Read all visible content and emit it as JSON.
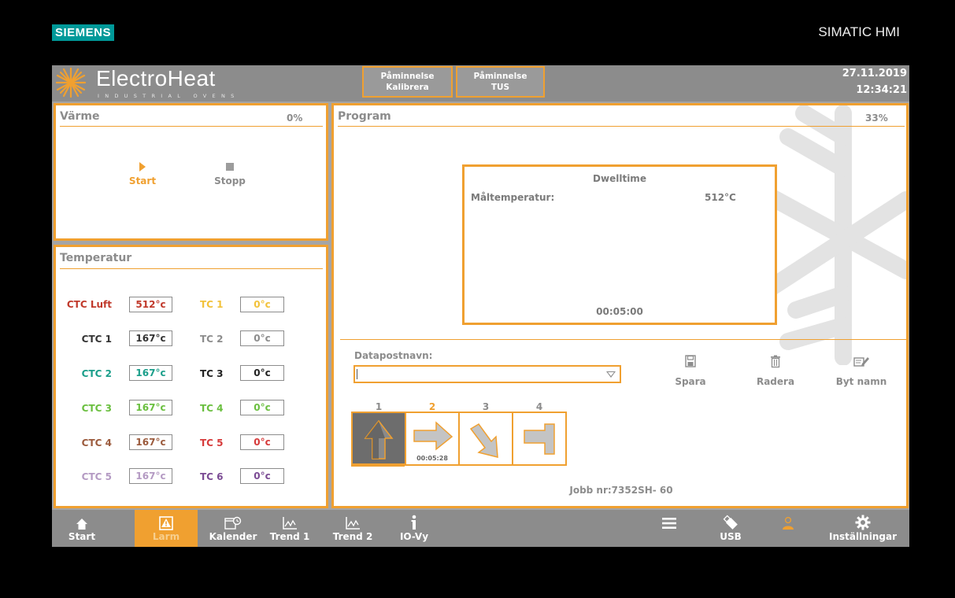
{
  "bezel": {
    "brand": "SIEMENS",
    "model": "SIMATIC HMI"
  },
  "header": {
    "logo_title": "ElectroHeat",
    "logo_subtitle": "INDUSTRIAL OVENS",
    "reminders": [
      {
        "line1": "Påminnelse",
        "line2": "Kalibrera"
      },
      {
        "line1": "Påminnelse",
        "line2": "TUS"
      }
    ],
    "date": "27.11.2019",
    "time": "12:34:21"
  },
  "varme": {
    "title": "Värme",
    "percent": "0%",
    "start_label": "Start",
    "stop_label": "Stopp"
  },
  "temperatur": {
    "title": "Temperatur",
    "left": [
      {
        "label": "CTC Luft",
        "value": "512°c",
        "color": "#c0392b"
      },
      {
        "label": "CTC 1",
        "value": "167°c",
        "color": "#333333"
      },
      {
        "label": "CTC 2",
        "value": "167°c",
        "color": "#1a9e8a"
      },
      {
        "label": "CTC 3",
        "value": "167°c",
        "color": "#6abf3f"
      },
      {
        "label": "CTC 4",
        "value": "167°c",
        "color": "#9b5a3c"
      },
      {
        "label": "CTC 5",
        "value": "167°c",
        "color": "#b49ac3"
      }
    ],
    "right": [
      {
        "label": "TC 1",
        "value": "0°c",
        "color": "#f2c23a"
      },
      {
        "label": "TC 2",
        "value": "0°c",
        "color": "#8c8c8c"
      },
      {
        "label": "TC 3",
        "value": "0°c",
        "color": "#222222"
      },
      {
        "label": "TC 4",
        "value": "0°c",
        "color": "#6abf3f"
      },
      {
        "label": "TC 5",
        "value": "0°c",
        "color": "#d63a3a"
      },
      {
        "label": "TC 6",
        "value": "0°c",
        "color": "#7b4b94"
      }
    ]
  },
  "program": {
    "title": "Program",
    "percent": "33%",
    "dwell": {
      "title": "Dwelltime",
      "target_label": "Måltemperatur:",
      "target_value": "512°C",
      "time": "00:05:00"
    },
    "datapost_label": "Datapostnavn:",
    "datapost_value": "",
    "actions": {
      "save": "Spara",
      "delete": "Radera",
      "rename": "Byt namn"
    },
    "steps": [
      {
        "num": "1",
        "icon": "arrow-up-icon",
        "time": ""
      },
      {
        "num": "2",
        "icon": "arrow-right-icon",
        "time": "00:05:28"
      },
      {
        "num": "3",
        "icon": "arrow-down-right-icon",
        "time": ""
      },
      {
        "num": "4",
        "icon": "flat-hold-icon",
        "time": ""
      }
    ],
    "active_step": "2",
    "jobb": "Jobb nr:7352SH- 60"
  },
  "nav": {
    "start": "Start",
    "larm": "Larm",
    "kalender": "Kalender",
    "trend1": "Trend 1",
    "trend2": "Trend 2",
    "io": "IO-Vy",
    "usb": "USB",
    "settings": "Inställningar"
  },
  "colors": {
    "accent": "#f0a030",
    "frame": "#8c8c8c"
  }
}
